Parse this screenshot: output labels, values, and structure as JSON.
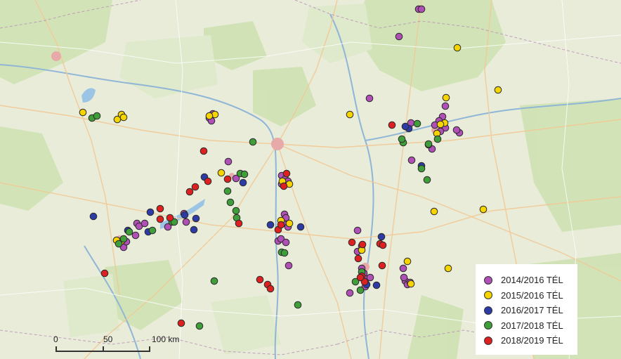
{
  "colors": {
    "2014_2016": "#b04fb5",
    "2015_2016": "#f6d400",
    "2016_2017": "#2e3aa6",
    "2017_2018": "#3f9e3a",
    "2018_2019": "#dd2020"
  },
  "legend": [
    {
      "key": "2014_2016",
      "label": "2014/2016 TÉL"
    },
    {
      "key": "2015_2016",
      "label": "2015/2016 TÉL"
    },
    {
      "key": "2016_2017",
      "label": "2016/2017 TÉL"
    },
    {
      "key": "2017_2018",
      "label": "2017/2018 TÉL"
    },
    {
      "key": "2018_2019",
      "label": "2018/2019 TÉL"
    }
  ],
  "scale": {
    "labels": [
      "0",
      "50",
      "100 km"
    ]
  },
  "sightings": {
    "2014_2016": [
      [
        596,
        13
      ],
      [
        600,
        13
      ],
      [
        568,
        52
      ],
      [
        526,
        140
      ],
      [
        634,
        151
      ],
      [
        630,
        166
      ],
      [
        625,
        172
      ],
      [
        630,
        177
      ],
      [
        634,
        182
      ],
      [
        619,
        178
      ],
      [
        627,
        187
      ],
      [
        654,
        189
      ],
      [
        650,
        185
      ],
      [
        615,
        212
      ],
      [
        586,
        228
      ],
      [
        585,
        175
      ],
      [
        325,
        230
      ],
      [
        336,
        254
      ],
      [
        401,
        250
      ],
      [
        406,
        255
      ],
      [
        401,
        262
      ],
      [
        410,
        258
      ],
      [
        405,
        305
      ],
      [
        407,
        310
      ],
      [
        403,
        318
      ],
      [
        410,
        323
      ],
      [
        396,
        343
      ],
      [
        400,
        340
      ],
      [
        407,
        345
      ],
      [
        411,
        378
      ],
      [
        239,
        323
      ],
      [
        195,
        318
      ],
      [
        198,
        322
      ],
      [
        206,
        318
      ],
      [
        193,
        335
      ],
      [
        176,
        352
      ],
      [
        180,
        344
      ],
      [
        265,
        316
      ],
      [
        262,
        304
      ],
      [
        298,
        168
      ],
      [
        301,
        172
      ],
      [
        303,
        162
      ],
      [
        509,
        328
      ],
      [
        515,
        350
      ],
      [
        509,
        358
      ],
      [
        515,
        382
      ],
      [
        518,
        389
      ],
      [
        521,
        397
      ],
      [
        527,
        395
      ],
      [
        498,
        417
      ],
      [
        574,
        382
      ],
      [
        577,
        400
      ],
      [
        580,
        405
      ],
      [
        584,
        402
      ],
      [
        575,
        395
      ],
      [
        520,
        408
      ]
    ],
    "2015_2016": [
      [
        651,
        68
      ],
      [
        709,
        128
      ],
      [
        635,
        139
      ],
      [
        498,
        163
      ],
      [
        622,
        190
      ],
      [
        633,
        175
      ],
      [
        627,
        177
      ],
      [
        618,
        301
      ],
      [
        688,
        298
      ],
      [
        638,
        382
      ],
      [
        402,
        258
      ],
      [
        412,
        262
      ],
      [
        400,
        314
      ],
      [
        412,
        318
      ],
      [
        515,
        356
      ],
      [
        173,
        343
      ],
      [
        166,
        342
      ],
      [
        315,
        246
      ],
      [
        306,
        163
      ],
      [
        298,
        165
      ],
      [
        580,
        372
      ],
      [
        585,
        404
      ],
      [
        118,
        160
      ],
      [
        167,
        170
      ],
      [
        173,
        163
      ],
      [
        176,
        167
      ]
    ],
    "2016_2017": [
      [
        133,
        308
      ],
      [
        214,
        302
      ],
      [
        182,
        328
      ],
      [
        263,
        306
      ],
      [
        279,
        311
      ],
      [
        276,
        327
      ],
      [
        291,
        252
      ],
      [
        346,
        260
      ],
      [
        428,
        323
      ],
      [
        385,
        320
      ],
      [
        543,
        337
      ],
      [
        536,
        406
      ],
      [
        582,
        183
      ],
      [
        577,
        180
      ],
      [
        600,
        236
      ],
      [
        522,
        405
      ],
      [
        211,
        330
      ]
    ],
    "2017_2018": [
      [
        131,
        168
      ],
      [
        138,
        165
      ],
      [
        360,
        202
      ],
      [
        324,
        272
      ],
      [
        328,
        288
      ],
      [
        336,
        300
      ],
      [
        337,
        310
      ],
      [
        342,
        247
      ],
      [
        348,
        248
      ],
      [
        401,
        359
      ],
      [
        405,
        360
      ],
      [
        169,
        347
      ],
      [
        176,
        340
      ],
      [
        184,
        330
      ],
      [
        217,
        328
      ],
      [
        245,
        316
      ],
      [
        248,
        316
      ],
      [
        305,
        400
      ],
      [
        424,
        434
      ],
      [
        284,
        464
      ],
      [
        594,
        176
      ],
      [
        574,
        203
      ],
      [
        572,
        198
      ],
      [
        610,
        206
      ],
      [
        600,
        240
      ],
      [
        608,
        256
      ],
      [
        623,
        198
      ],
      [
        515,
        387
      ],
      [
        513,
        413
      ],
      [
        506,
        401
      ],
      [
        610,
        205
      ]
    ],
    "2018_2019": [
      [
        290,
        215
      ],
      [
        296,
        258
      ],
      [
        278,
        266
      ],
      [
        270,
        273
      ],
      [
        228,
        297
      ],
      [
        228,
        312
      ],
      [
        242,
        310
      ],
      [
        340,
        318
      ],
      [
        408,
        247
      ],
      [
        404,
        265
      ],
      [
        396,
        327
      ],
      [
        400,
        320
      ],
      [
        324,
        255
      ],
      [
        149,
        389
      ],
      [
        370,
        398
      ],
      [
        381,
        405
      ],
      [
        385,
        411
      ],
      [
        258,
        460
      ],
      [
        558,
        178
      ],
      [
        501,
        345
      ],
      [
        510,
        368
      ],
      [
        516,
        348
      ],
      [
        541,
        347
      ],
      [
        545,
        349
      ],
      [
        544,
        378
      ],
      [
        515,
        393
      ],
      [
        519,
        401
      ],
      [
        513,
        395
      ]
    ]
  }
}
